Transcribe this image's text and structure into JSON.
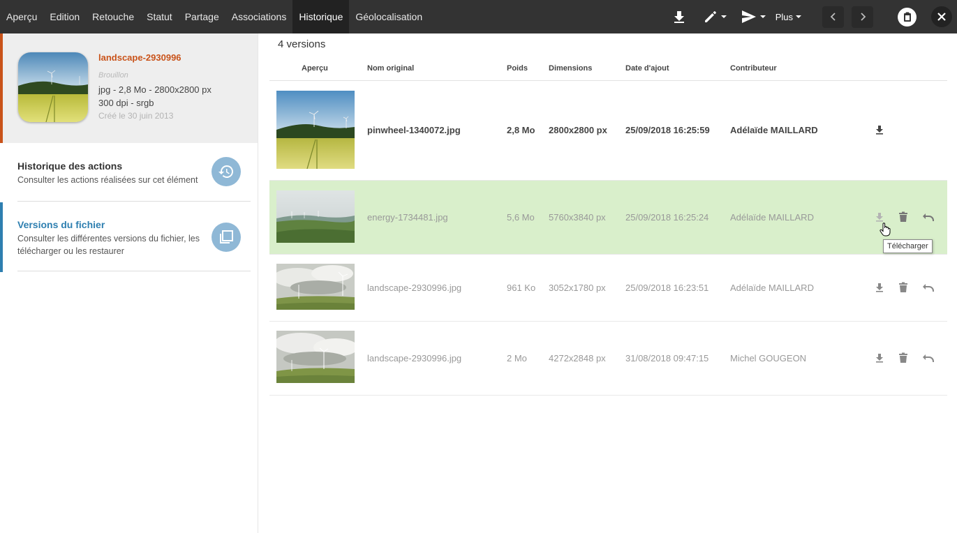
{
  "topbar": {
    "tabs": [
      {
        "label": "Aperçu",
        "active": false
      },
      {
        "label": "Edition",
        "active": false
      },
      {
        "label": "Retouche",
        "active": false
      },
      {
        "label": "Statut",
        "active": false
      },
      {
        "label": "Partage",
        "active": false
      },
      {
        "label": "Associations",
        "active": false
      },
      {
        "label": "Historique",
        "active": true
      },
      {
        "label": "Géolocalisation",
        "active": false
      }
    ],
    "more_label": "Plus",
    "icons": [
      "download-icon",
      "pencil-icon",
      "send-icon",
      "chevron-left-icon",
      "chevron-right-icon",
      "clipboard-icon",
      "close-icon"
    ]
  },
  "asset": {
    "name": "landscape-2930996",
    "status": "Brouillon",
    "format_line": "jpg - 2,8 Mo - 2800x2800 px",
    "dpi_line": "300 dpi - srgb",
    "created": "Créé le 30 juin 2013"
  },
  "sections": {
    "history": {
      "title": "Historique des actions",
      "desc": "Consulter les actions réalisées sur cet élément",
      "icon": "history-icon"
    },
    "versions": {
      "title": "Versions du fichier",
      "desc": "Consulter les différentes versions du fichier, les télécharger ou les restaurer",
      "icon": "versions-icon"
    }
  },
  "main": {
    "count_label": "4 versions",
    "headers": {
      "preview": "Aperçu",
      "name": "Nom original",
      "weight": "Poids",
      "dimensions": "Dimensions",
      "date": "Date d'ajout",
      "contributor": "Contributeur"
    },
    "rows": [
      {
        "name": "pinwheel-1340072.jpg",
        "weight": "2,8 Mo",
        "dimensions": "2800x2800 px",
        "date": "25/09/2018 16:25:59",
        "contributor": "Adélaïde MAILLARD",
        "current": true
      },
      {
        "name": "energy-1734481.jpg",
        "weight": "5,6 Mo",
        "dimensions": "5760x3840 px",
        "date": "25/09/2018 16:25:24",
        "contributor": "Adélaïde MAILLARD",
        "current": false
      },
      {
        "name": "landscape-2930996.jpg",
        "weight": "961 Ko",
        "dimensions": "3052x1780 px",
        "date": "25/09/2018 16:23:51",
        "contributor": "Adélaïde MAILLARD",
        "current": false
      },
      {
        "name": "landscape-2930996.jpg",
        "weight": "2 Mo",
        "dimensions": "4272x2848 px",
        "date": "31/08/2018 09:47:15",
        "contributor": "Michel GOUGEON",
        "current": false
      }
    ],
    "tooltip": "Télécharger"
  },
  "colors": {
    "topbar": "#333333",
    "accent_orange": "#c9531a",
    "accent_blue": "#2e7fb0",
    "row_highlight": "#d9efcb",
    "section_icon": "#8fb8d6"
  }
}
